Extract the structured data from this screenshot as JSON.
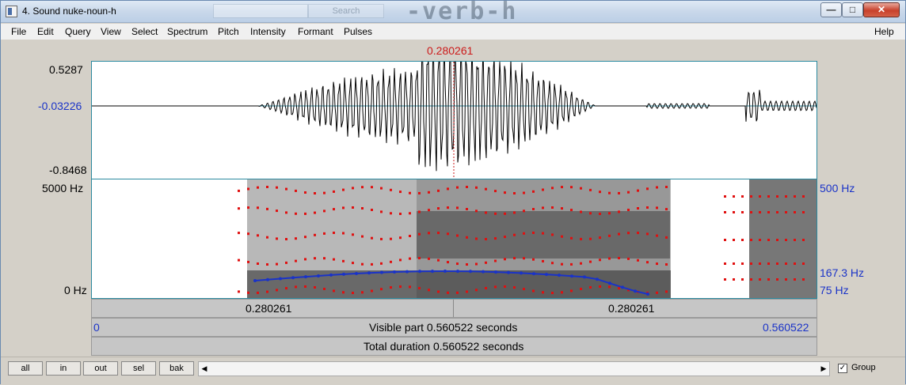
{
  "window": {
    "title": "4. Sound nuke-noun-h",
    "background_title_fragment": "-verb-h",
    "background_input_text": "Search"
  },
  "menu": [
    "File",
    "Edit",
    "Query",
    "View",
    "Select",
    "Spectrum",
    "Pitch",
    "Intensity",
    "Formant",
    "Pulses"
  ],
  "menu_help": "Help",
  "cursor_time": "0.280261",
  "waveform": {
    "ymax": "0.5287",
    "ymid": "-0.03226",
    "ymin": "-0.8468"
  },
  "spectrogram": {
    "fmax": "5000 Hz",
    "fmin": "0 Hz",
    "pitch_top": "500 Hz",
    "pitch_cursor": "167.3 Hz",
    "pitch_bottom": "75 Hz"
  },
  "time_bar": {
    "left": "0.280261",
    "right": "0.280261"
  },
  "visible_bar": {
    "start": "0",
    "label": "Visible part 0.560522 seconds",
    "end": "0.560522"
  },
  "total_bar": {
    "label": "Total duration 0.560522 seconds"
  },
  "buttons": {
    "all": "all",
    "in": "in",
    "out": "out",
    "sel": "sel",
    "bak": "bak"
  },
  "group_label": "Group",
  "group_checked": true,
  "colors": {
    "cursor": "#cc1a1a",
    "pitch": "#1a33c8",
    "frame": "#2c8aa0"
  }
}
